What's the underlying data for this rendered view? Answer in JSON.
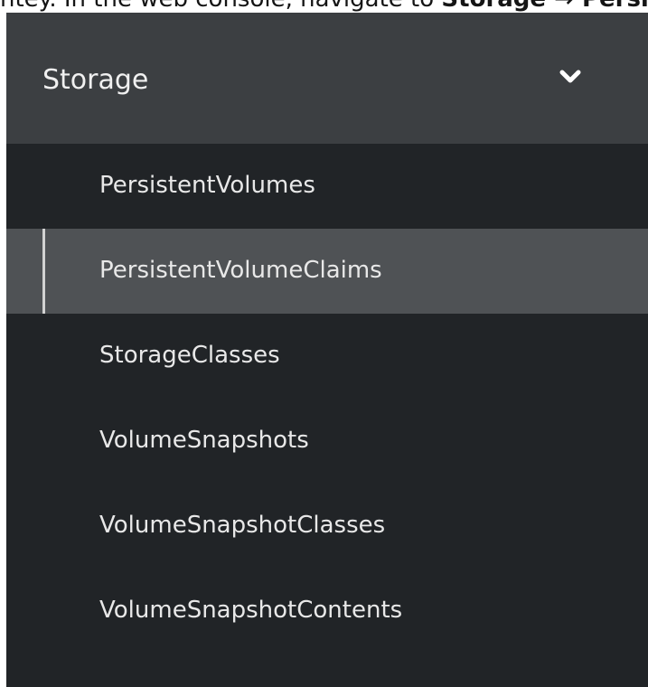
{
  "caption": {
    "prefix": "ntey. In the web console, navigate to ",
    "bold": "Storage → Persiste"
  },
  "nav": {
    "section_title": "Storage",
    "chevron_icon": "chevron-down-icon",
    "items": [
      {
        "label": "PersistentVolumes",
        "active": false
      },
      {
        "label": "PersistentVolumeClaims",
        "active": true
      },
      {
        "label": "StorageClasses",
        "active": false
      },
      {
        "label": "VolumeSnapshots",
        "active": false
      },
      {
        "label": "VolumeSnapshotClasses",
        "active": false
      },
      {
        "label": "VolumeSnapshotContents",
        "active": false
      }
    ]
  },
  "colors": {
    "nav_background": "#212427",
    "section_header_background": "#3c3f42",
    "active_item_background": "#4f5255",
    "active_indicator": "#d2d2d2",
    "text": "#e8e8e8"
  }
}
